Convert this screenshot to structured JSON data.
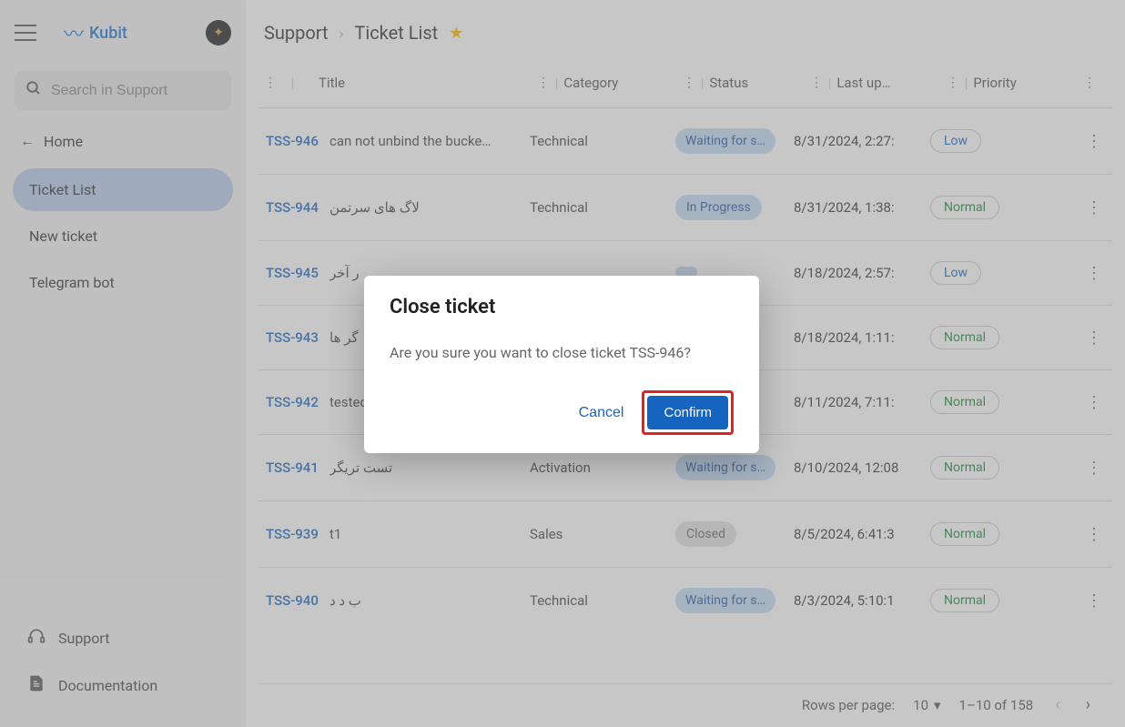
{
  "brand": {
    "name": "Kubit"
  },
  "search": {
    "placeholder": "Search in Support"
  },
  "nav": {
    "home": "Home",
    "items": [
      {
        "label": "Ticket List",
        "active": true
      },
      {
        "label": "New ticket",
        "active": false
      },
      {
        "label": "Telegram bot",
        "active": false
      }
    ]
  },
  "footer": {
    "support": "Support",
    "docs": "Documentation"
  },
  "breadcrumb": {
    "root": "Support",
    "page": "Ticket List"
  },
  "table": {
    "headers": {
      "title": "Title",
      "category": "Category",
      "status": "Status",
      "lastup": "Last up…",
      "priority": "Priority"
    },
    "rows": [
      {
        "id": "TSS-946",
        "title": "can not unbind the bucke…",
        "category": "Technical",
        "status": "Waiting for s…",
        "statusClass": "status-waiting",
        "date": "8/31/2024, 2:27:",
        "priority": "Low",
        "prioClass": "prio-low"
      },
      {
        "id": "TSS-944",
        "title": "لاگ های سرتمن",
        "category": "Technical",
        "status": "In Progress",
        "statusClass": "status-progress",
        "date": "8/31/2024, 1:38:",
        "priority": "Normal",
        "prioClass": "prio-normal"
      },
      {
        "id": "TSS-945",
        "title": "ر آخر",
        "category": "",
        "status": "",
        "statusClass": "status-waiting",
        "date": "8/18/2024, 2:57:",
        "priority": "Low",
        "prioClass": "prio-low"
      },
      {
        "id": "TSS-943",
        "title": "گر ها",
        "category": "",
        "status": "",
        "statusClass": "status-waiting",
        "date": "8/18/2024, 1:11:",
        "priority": "Normal",
        "prioClass": "prio-normal"
      },
      {
        "id": "TSS-942",
        "title": "tested افزایش اعتبار",
        "category": "",
        "status": "",
        "statusClass": "status-waiting",
        "date": "8/11/2024, 7:11:",
        "priority": "Normal",
        "prioClass": "prio-normal"
      },
      {
        "id": "TSS-941",
        "title": "تست تریگر",
        "category": "Activation",
        "status": "Waiting for s…",
        "statusClass": "status-waiting",
        "date": "8/10/2024, 12:08",
        "priority": "Normal",
        "prioClass": "prio-normal"
      },
      {
        "id": "TSS-939",
        "title": "t1",
        "category": "Sales",
        "status": "Closed",
        "statusClass": "status-closed",
        "date": "8/5/2024, 6:41:3",
        "priority": "Normal",
        "prioClass": "prio-normal"
      },
      {
        "id": "TSS-940",
        "title": "ب د د",
        "category": "Technical",
        "status": "Waiting for s…",
        "statusClass": "status-waiting",
        "date": "8/3/2024, 5:10:1",
        "priority": "Normal",
        "prioClass": "prio-normal"
      }
    ]
  },
  "pager": {
    "rppLabel": "Rows per page:",
    "rpp": "10",
    "range": "1–10 of 158"
  },
  "dialog": {
    "title": "Close ticket",
    "body": "Are you sure you want to close ticket TSS-946?",
    "cancel": "Cancel",
    "confirm": "Confirm"
  }
}
